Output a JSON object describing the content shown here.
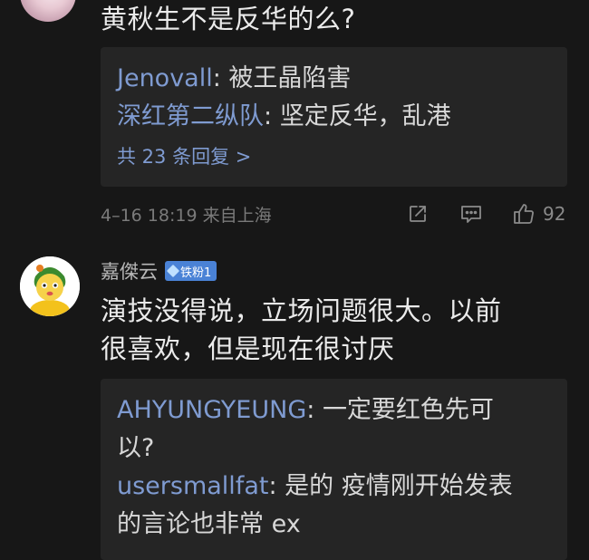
{
  "comment1": {
    "text": "黄秋生不是反华的么?",
    "replies": [
      {
        "user": "Jenovall",
        "sep": ": ",
        "text": "被王晶陷害"
      },
      {
        "user": "深红第二纵队",
        "sep": ": ",
        "text": "坚定反华，乱港"
      }
    ],
    "more_replies": "共 23 条回复 >",
    "meta": "4–16 18:19 来自上海",
    "like_count": "92",
    "icons": [
      "share-icon",
      "comment-icon",
      "like-icon"
    ]
  },
  "comment2": {
    "username": "嘉傑云",
    "badge": "铁粉1",
    "text_line1": "演技没得说，立场问题很大。以前",
    "text_line2": "很喜欢，但是现在很讨厌",
    "replies": [
      {
        "user": "AHYUNGYEUNG",
        "sep": ": ",
        "text_line1": "一定要红色先可",
        "text_line2": "以?"
      },
      {
        "user": "usersmallfat",
        "sep": ": ",
        "text_line1": "是的 疫情刚开始发表",
        "text_line2": "的言论也非常 ex"
      }
    ]
  },
  "colors": {
    "background": "#171717",
    "reply_box": "#252525",
    "username_link": "#7f9bd1",
    "badge": "#4a82d6"
  }
}
